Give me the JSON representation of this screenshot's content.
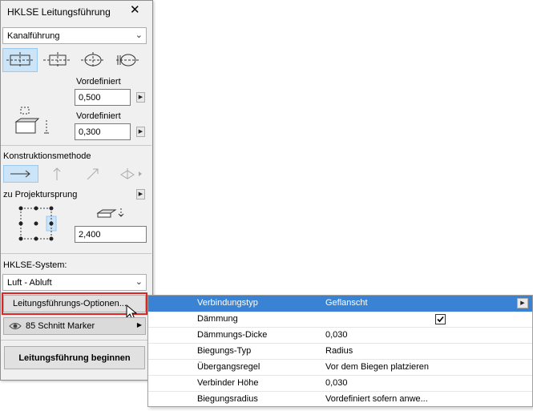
{
  "window": {
    "title": "HKLSE Leitungsführung",
    "close_label": "✕"
  },
  "placement": {
    "dropdown_value": "Kanalführung",
    "icon_names": [
      "duct-center-icon",
      "duct-round-icon",
      "duct-oval-icon",
      "duct-flex-icon"
    ]
  },
  "dimensions": {
    "width_label": "Vordefiniert",
    "width_value": "0,500",
    "height_label": "Vordefiniert",
    "height_value": "0,300"
  },
  "construction": {
    "label": "Konstruktionsmethode",
    "origin_label": "zu Projektursprung",
    "offset_value": "2,400"
  },
  "system": {
    "label": "HKLSE-System:",
    "value": "Luft - Abluft"
  },
  "options_button": "Leitungsführungs-Optionen...",
  "marker": {
    "label": "85 Schnitt Marker"
  },
  "begin_button": "Leitungsführung beginnen",
  "options_table": {
    "rows": [
      {
        "key": "Verbindungstyp",
        "value": "Geflanscht"
      },
      {
        "key": "Dämmung",
        "value": ""
      },
      {
        "key": "Dämmungs-Dicke",
        "value": "0,030"
      },
      {
        "key": "Biegungs-Typ",
        "value": "Radius"
      },
      {
        "key": "Übergangsregel",
        "value": "Vor dem Biegen platzieren"
      },
      {
        "key": "Verbinder Höhe",
        "value": "0,030"
      },
      {
        "key": "Biegungsradius",
        "value": "Vordefiniert sofern anwe..."
      }
    ],
    "insulation_checked": true
  },
  "colors": {
    "selection": "#3a82d3",
    "highlight_border": "#e02424",
    "selected_icon_bg": "#cce4f7"
  }
}
